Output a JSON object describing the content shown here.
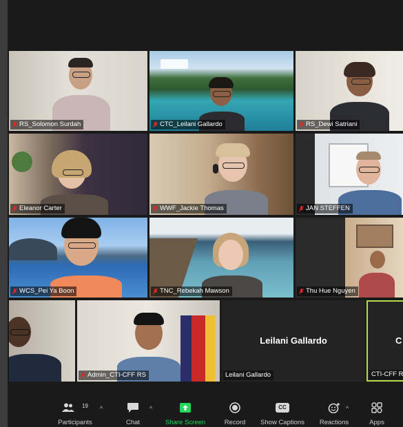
{
  "participants": [
    {
      "tag": "RS_Solomon Surdah"
    },
    {
      "tag": "CTC_Leilani Gallardo"
    },
    {
      "tag": "RS_Dewi Satriani"
    },
    {
      "tag": "Eleanor Carter"
    },
    {
      "tag": "WWF_Jackie Thomas"
    },
    {
      "tag": "JAN STEFFEN"
    },
    {
      "tag": "WCS_Pei Ya Boon"
    },
    {
      "tag": "TNC_Rebekah Mawson"
    },
    {
      "tag": "Thu Hue Nguyen"
    },
    {
      "tag": ""
    },
    {
      "tag": "Admin_CTI-CFF RS"
    },
    {
      "tag": "Leilani Gallardo",
      "big_name": "Leilani Gallardo"
    },
    {
      "tag": "CTI-CFF Re",
      "big_name": "C"
    }
  ],
  "toolbar": {
    "participants_label": "Participants",
    "participants_count": "19",
    "chat_label": "Chat",
    "share_label": "Share Screen",
    "record_label": "Record",
    "captions_label": "Show Captions",
    "captions_icon_text": "CC",
    "reactions_label": "Reactions",
    "apps_label": "Apps"
  },
  "colors": {
    "background": "#1a1a1a",
    "share_accent": "#23d959",
    "mic_muted": "#e02828",
    "active_speaker_border": "#b7d94a"
  },
  "icons": [
    "participants-icon",
    "chat-icon",
    "share-screen-icon",
    "record-icon",
    "captions-icon",
    "reactions-icon",
    "apps-icon",
    "mic-muted-icon"
  ]
}
